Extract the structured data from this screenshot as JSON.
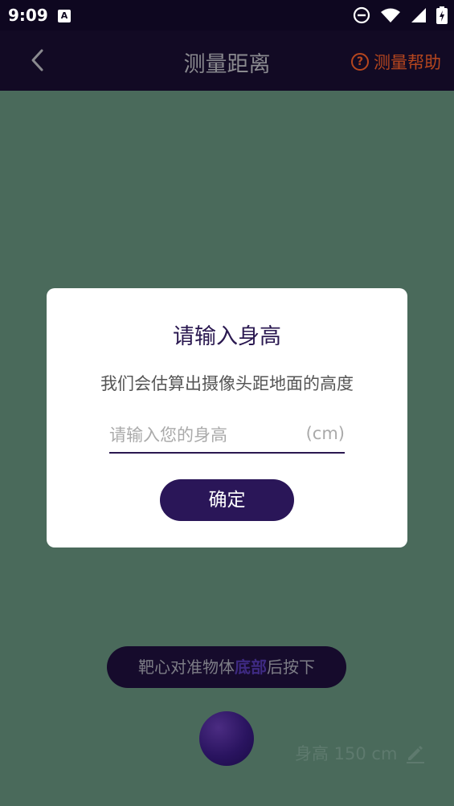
{
  "status": {
    "time": "9:09",
    "notification_icon_label": "A"
  },
  "appbar": {
    "title": "测量距离",
    "help_label": "测量帮助",
    "help_icon_glyph": "?"
  },
  "screen": {
    "tip_prefix": "靶心对准物体",
    "tip_emphasis": "底部",
    "tip_suffix": "后按下",
    "height_info": "身高 150 cm"
  },
  "dialog": {
    "title": "请输入身高",
    "subtitle": "我们会估算出摄像头距地面的高度",
    "input_placeholder": "请输入您的身高",
    "input_value": "",
    "unit": "(cm)",
    "confirm_label": "确定"
  },
  "colors": {
    "accent": "#2a1658",
    "help": "#b5461e",
    "background": "#4a6a5b",
    "bar": "#120a24"
  }
}
